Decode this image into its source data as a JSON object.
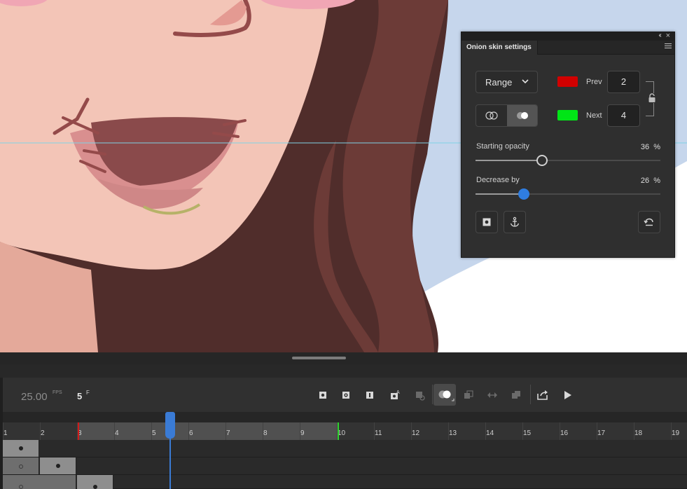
{
  "onion_panel": {
    "title": "Onion skin settings",
    "mode_dropdown": "Range",
    "prev_label": "Prev",
    "next_label": "Next",
    "prev_value": "2",
    "next_value": "4",
    "prev_color": "#d10000",
    "next_color": "#00e516",
    "starting_opacity_label": "Starting opacity",
    "starting_opacity_value": "36",
    "starting_opacity_fraction": 0.36,
    "decrease_by_label": "Decrease by",
    "decrease_by_value": "26",
    "decrease_by_fraction": 0.26,
    "percent_unit": "%",
    "icons": [
      "collapse-icon",
      "close-icon",
      "panel-menu-icon",
      "chevron-down-icon",
      "lock-icon",
      "outline-onion-icon",
      "filled-onion-icon",
      "keyframe-icon",
      "anchor-icon",
      "reset-icon"
    ]
  },
  "timeline": {
    "fps_value": "25.00",
    "fps_unit": "FPS",
    "current_frame": "5",
    "frame_unit": "F",
    "ruler_numbers": [
      "1",
      "2",
      "3",
      "4",
      "5",
      "6",
      "7",
      "8",
      "9",
      "10",
      "11",
      "12",
      "13",
      "14",
      "15",
      "16",
      "17",
      "18",
      "19"
    ],
    "onion_start_frame": 3,
    "onion_end_frame": 9,
    "playhead_frame": 5,
    "toolbar_icons": [
      "insert-keyframe-icon",
      "insert-blank-keyframe-icon",
      "insert-frame-icon",
      "camera-icon",
      "layer-depth-icon",
      "onion-skin-icon",
      "edit-multiple-frames-icon",
      "loop-icon",
      "onion-outline-icon",
      "export-icon",
      "play-icon"
    ],
    "accent_colors": {
      "playhead": "#3a7bd5",
      "onion_start": "#d11a1a",
      "onion_end": "#2ed12e"
    }
  }
}
